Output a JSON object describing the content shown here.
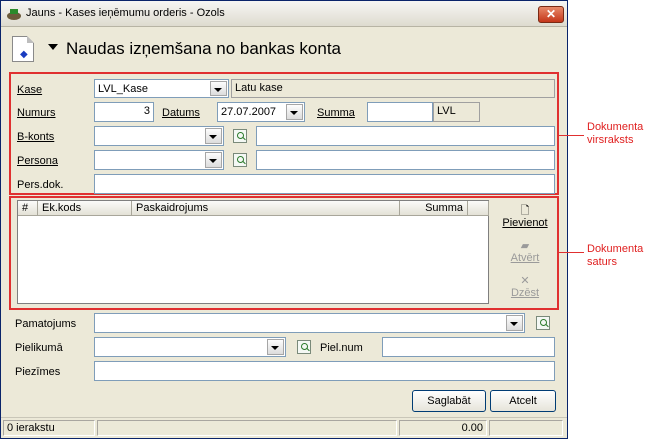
{
  "window": {
    "title": "Jauns - Kases ieņēmumu orderis - Ozols",
    "close_label": "✕"
  },
  "header": {
    "title": "Naudas izņemšana no bankas konta"
  },
  "form": {
    "kase": {
      "label": "Kase",
      "value": "LVL_Kase",
      "description": "Latu kase"
    },
    "numurs": {
      "label": "Numurs",
      "value": "3"
    },
    "datums": {
      "label": "Datums",
      "value": "27.07.2007"
    },
    "summa": {
      "label": "Summa",
      "value": "",
      "currency": "LVL"
    },
    "bkonts": {
      "label": "B-konts",
      "value": "",
      "description": ""
    },
    "persona": {
      "label": "Persona",
      "value": "",
      "description": ""
    },
    "persdok": {
      "label": "Pers.dok.",
      "value": ""
    }
  },
  "grid": {
    "columns": [
      "#",
      "Ek.kods",
      "Paskaidrojums",
      "Summa"
    ],
    "rows": []
  },
  "side_buttons": {
    "add": "Pievienot",
    "open": "Atvērt",
    "delete": "Dzēst"
  },
  "footer": {
    "pamatojums": {
      "label": "Pamatojums",
      "value": ""
    },
    "pielikuma": {
      "label": "Pielikumā",
      "value": ""
    },
    "pielnum": {
      "label": "Piel.num",
      "value": ""
    },
    "piezimes": {
      "label": "Piezīmes",
      "value": ""
    }
  },
  "buttons": {
    "save": "Saglabāt",
    "cancel": "Atcelt"
  },
  "status": {
    "records": "0 ierakstu",
    "total": "0.00"
  },
  "annotations": {
    "header_line1": "Dokumenta",
    "header_line2": "virsraksts",
    "content_line1": "Dokumenta",
    "content_line2": "saturs"
  },
  "colors": {
    "highlight": "#e03030",
    "window_bg": "#ece9d8"
  }
}
